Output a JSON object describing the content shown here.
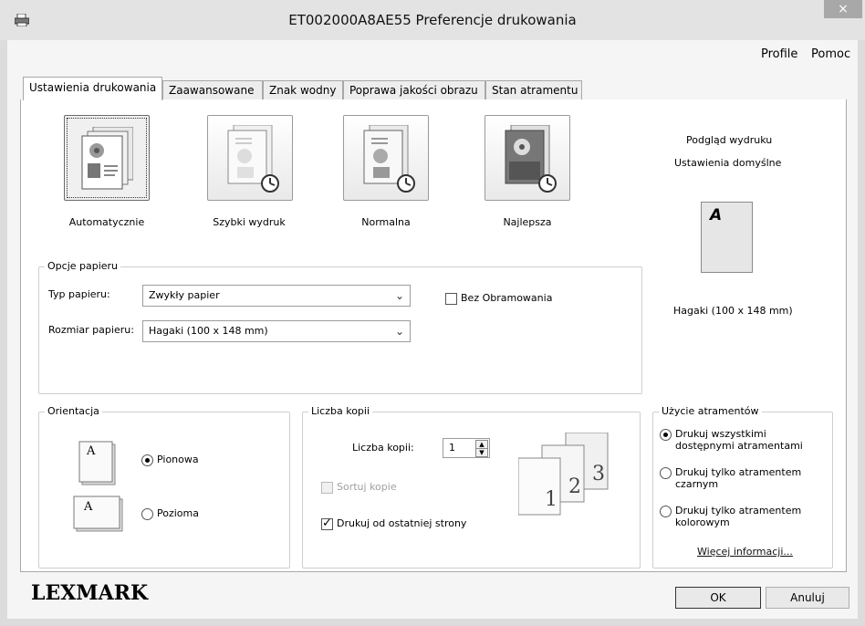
{
  "window": {
    "title": "ET002000A8AE55 Preferencje drukowania",
    "close": "×"
  },
  "menu": {
    "profile": "Profile",
    "help": "Pomoc"
  },
  "tabs": [
    "Ustawienia drukowania",
    "Zaawansowane",
    "Znak wodny",
    "Poprawa jakości obrazu",
    "Stan atramentu"
  ],
  "quality": {
    "items": [
      "Automatycznie",
      "Szybki wydruk",
      "Normalna",
      "Najlepsza"
    ],
    "selected": "Automatycznie"
  },
  "preview": {
    "title": "Podgląd wydruku",
    "subtitle": "Ustawienia domyślne",
    "page_letter": "A",
    "size": "Hagaki (100 x 148 mm)"
  },
  "paper": {
    "group_title": "Opcje papieru",
    "type_label": "Typ papieru:",
    "type_value": "Zwykły papier",
    "size_label": "Rozmiar papieru:",
    "size_value": "Hagaki (100 x 148 mm)",
    "borderless_label": "Bez Obramowania",
    "borderless_checked": false
  },
  "orientation": {
    "group_title": "Orientacja",
    "portrait": "Pionowa",
    "landscape": "Pozioma",
    "selected": "Pionowa",
    "icon_letter": "A"
  },
  "copies": {
    "group_title": "Liczba kopii",
    "label": "Liczba kopii:",
    "value": "1",
    "collate_label": "Sortuj kopie",
    "collate_checked": false,
    "collate_enabled": false,
    "reverse_label": "Drukuj od ostatniej strony",
    "reverse_checked": true,
    "stack_numbers": [
      "1",
      "2",
      "3"
    ]
  },
  "ink": {
    "group_title": "Użycie atramentów",
    "options": [
      "Drukuj wszystkimi dostępnymi atramentami",
      "Drukuj tylko atramentem czarnym",
      "Drukuj tylko atramentem kolorowym"
    ],
    "option_lines": [
      [
        "Drukuj wszystkimi",
        "dostępnymi atramentami"
      ],
      [
        "Drukuj tylko atramentem",
        "czarnym"
      ],
      [
        "Drukuj tylko atramentem",
        "kolorowym"
      ]
    ],
    "selected_index": 0,
    "more_info": "Więcej informacji..."
  },
  "footer": {
    "brand": "LEXMARK",
    "ok": "OK",
    "cancel": "Anuluj"
  }
}
